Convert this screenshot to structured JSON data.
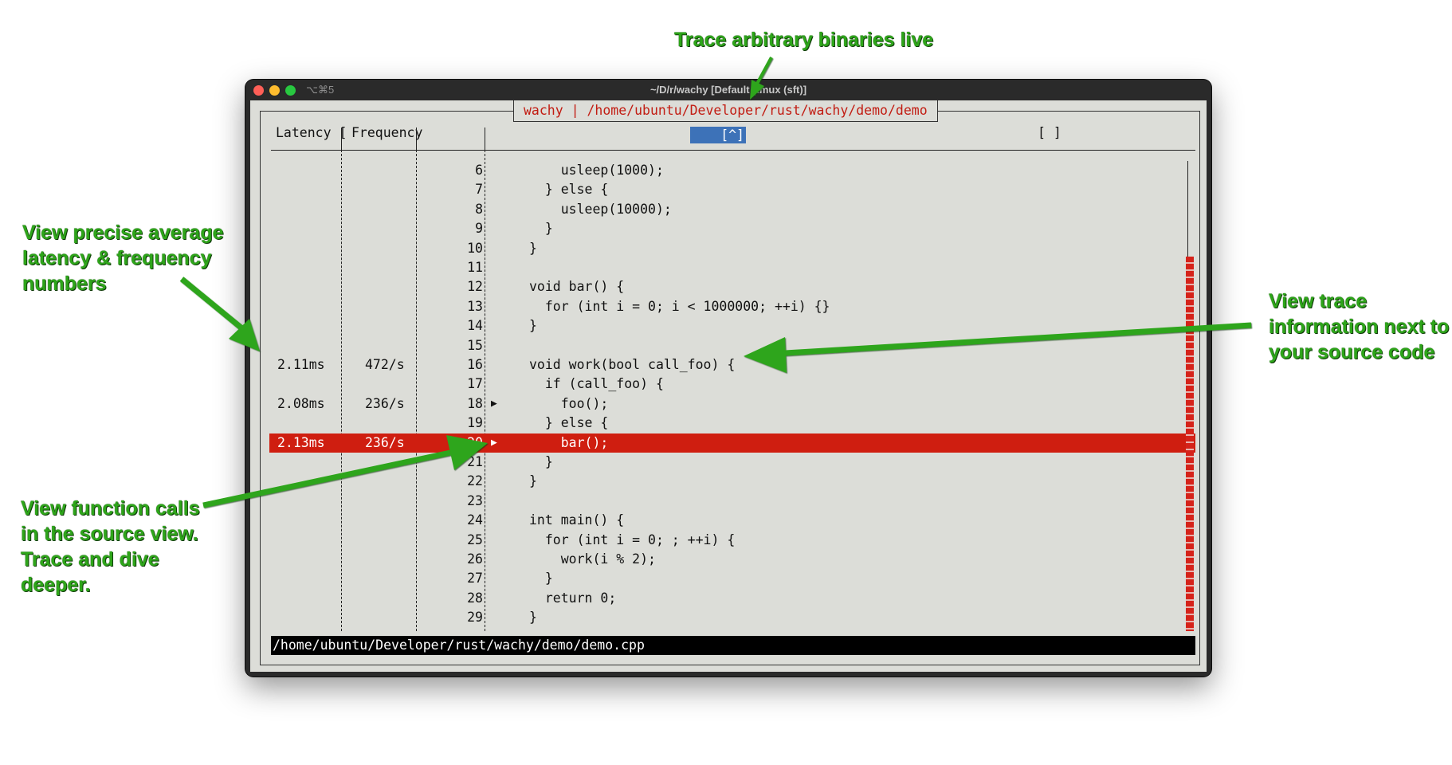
{
  "annotations": {
    "top": "Trace arbitrary binaries live",
    "left_top": [
      "View precise average",
      "latency & frequency",
      "numbers"
    ],
    "right": [
      "View trace",
      "information next to",
      "your source code"
    ],
    "left_bottom": [
      "View function calls",
      "in the source view.",
      "Trace and dive",
      "deeper."
    ],
    "color": "#2ea51a"
  },
  "window": {
    "title": "~/D/r/wachy [Default (tmux (sft)]",
    "shortcut": "⌥⌘5",
    "traffic_lights": [
      "#ff5f57",
      "#febc2e",
      "#28c840"
    ]
  },
  "app": {
    "header_title": "wachy | /home/ubuntu/Developer/rust/wachy/demo/demo",
    "columns": {
      "latency": "Latency [",
      "frequency": "Frequency",
      "search": "[^]",
      "right_bracket": "[ ]"
    },
    "rows": [
      {
        "latency": "",
        "frequency": "",
        "line": "6",
        "arrow": "",
        "code": "    usleep(1000);",
        "highlight": false
      },
      {
        "latency": "",
        "frequency": "",
        "line": "7",
        "arrow": "",
        "code": "  } else {",
        "highlight": false
      },
      {
        "latency": "",
        "frequency": "",
        "line": "8",
        "arrow": "",
        "code": "    usleep(10000);",
        "highlight": false
      },
      {
        "latency": "",
        "frequency": "",
        "line": "9",
        "arrow": "",
        "code": "  }",
        "highlight": false
      },
      {
        "latency": "",
        "frequency": "",
        "line": "10",
        "arrow": "",
        "code": "}",
        "highlight": false
      },
      {
        "latency": "",
        "frequency": "",
        "line": "11",
        "arrow": "",
        "code": "",
        "highlight": false
      },
      {
        "latency": "",
        "frequency": "",
        "line": "12",
        "arrow": "",
        "code": "void bar() {",
        "highlight": false
      },
      {
        "latency": "",
        "frequency": "",
        "line": "13",
        "arrow": "",
        "code": "  for (int i = 0; i < 1000000; ++i) {}",
        "highlight": false
      },
      {
        "latency": "",
        "frequency": "",
        "line": "14",
        "arrow": "",
        "code": "}",
        "highlight": false
      },
      {
        "latency": "",
        "frequency": "",
        "line": "15",
        "arrow": "",
        "code": "",
        "highlight": false
      },
      {
        "latency": "2.11ms",
        "frequency": "472/s",
        "line": "16",
        "arrow": "",
        "code": "void work(bool call_foo) {",
        "highlight": false
      },
      {
        "latency": "",
        "frequency": "",
        "line": "17",
        "arrow": "",
        "code": "  if (call_foo) {",
        "highlight": false
      },
      {
        "latency": "2.08ms",
        "frequency": "236/s",
        "line": "18",
        "arrow": "▶",
        "code": "    foo();",
        "highlight": false
      },
      {
        "latency": "",
        "frequency": "",
        "line": "19",
        "arrow": "",
        "code": "  } else {",
        "highlight": false
      },
      {
        "latency": "2.13ms",
        "frequency": "236/s",
        "line": "20",
        "arrow": "▶",
        "code": "    bar();",
        "highlight": true
      },
      {
        "latency": "",
        "frequency": "",
        "line": "21",
        "arrow": "",
        "code": "  }",
        "highlight": false
      },
      {
        "latency": "",
        "frequency": "",
        "line": "22",
        "arrow": "",
        "code": "}",
        "highlight": false
      },
      {
        "latency": "",
        "frequency": "",
        "line": "23",
        "arrow": "",
        "code": "",
        "highlight": false
      },
      {
        "latency": "",
        "frequency": "",
        "line": "24",
        "arrow": "",
        "code": "int main() {",
        "highlight": false
      },
      {
        "latency": "",
        "frequency": "",
        "line": "25",
        "arrow": "",
        "code": "  for (int i = 0; ; ++i) {",
        "highlight": false
      },
      {
        "latency": "",
        "frequency": "",
        "line": "26",
        "arrow": "",
        "code": "    work(i % 2);",
        "highlight": false
      },
      {
        "latency": "",
        "frequency": "",
        "line": "27",
        "arrow": "",
        "code": "  }",
        "highlight": false
      },
      {
        "latency": "",
        "frequency": "",
        "line": "28",
        "arrow": "",
        "code": "  return 0;",
        "highlight": false
      },
      {
        "latency": "",
        "frequency": "",
        "line": "29",
        "arrow": "",
        "code": "}",
        "highlight": false
      }
    ],
    "status_path": "/home/ubuntu/Developer/rust/wachy/demo/demo.cpp",
    "colors": {
      "terminal_bg": "#dcddd8",
      "highlight": "#cf1e10",
      "title_red": "#c21c12",
      "search_blue": "#3d72b8"
    }
  }
}
